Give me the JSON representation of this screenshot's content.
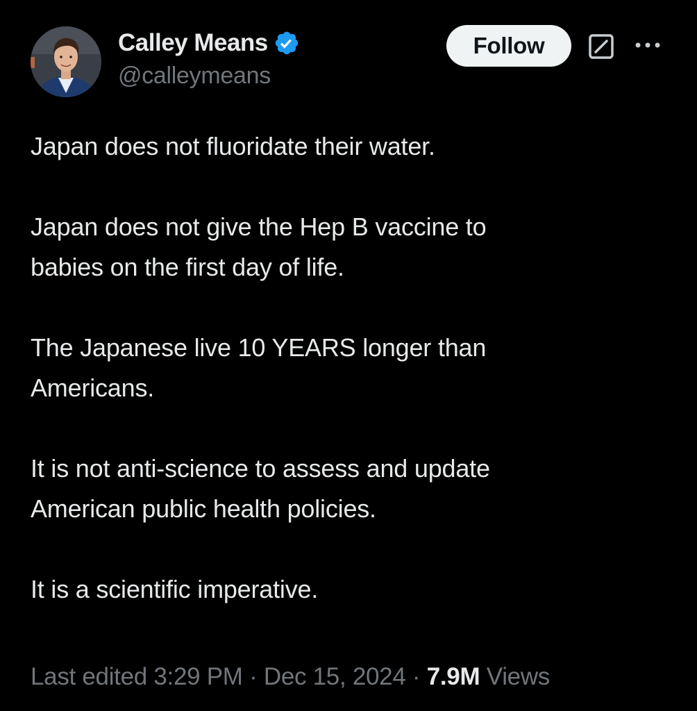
{
  "author": {
    "display_name": "Calley Means",
    "handle": "@calleymeans",
    "verified": true
  },
  "actions": {
    "follow_label": "Follow"
  },
  "icons": {
    "verified": "verified-badge-icon",
    "grok": "grok-icon",
    "more": "more-options-icon"
  },
  "colors": {
    "background": "#000000",
    "text": "#e7e9ea",
    "secondary_text": "#71767b",
    "verified_blue": "#1d9bf0",
    "follow_bg": "#eff3f4"
  },
  "tweet": {
    "paragraphs": [
      "Japan does not fluoridate their water.",
      "Japan does not give the Hep B vaccine to\nbabies on the first day of life.",
      "The Japanese live 10 YEARS longer than\nAmericans.",
      "It is not anti-science to assess and update\nAmerican public health policies.",
      "It is a scientific imperative."
    ],
    "edited_label": "Last edited",
    "time": "3:29 PM",
    "date": "Dec 15, 2024",
    "separator": "·",
    "views_count": "7.9M",
    "views_label": "Views"
  }
}
